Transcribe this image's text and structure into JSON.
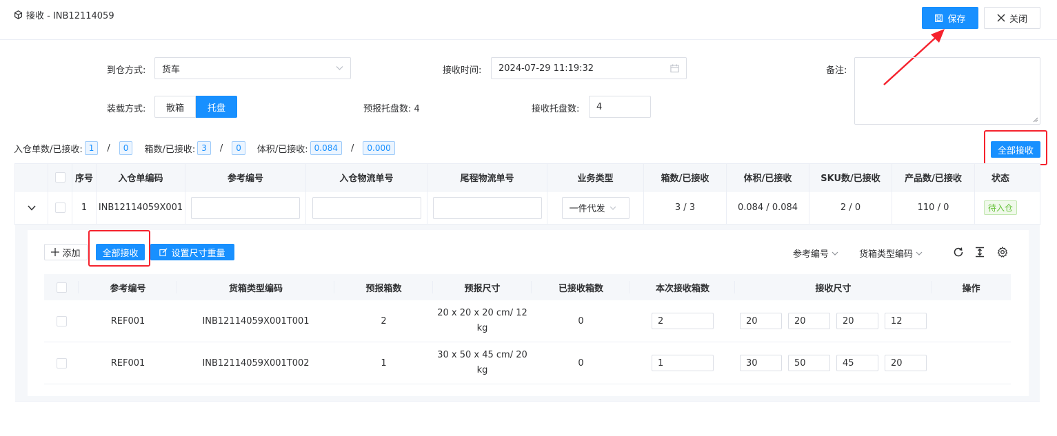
{
  "header": {
    "title": "接收 - INB12114059",
    "save_label": "保存",
    "close_label": "关闭"
  },
  "form": {
    "arrival_label": "到仓方式:",
    "arrival_value": "货车",
    "receive_time_label": "接收时间:",
    "receive_time_value": "2024-07-29 11:19:32",
    "remark_label": "备注:",
    "load_label": "装载方式:",
    "load_options": [
      "散箱",
      "托盘"
    ],
    "load_selected": "托盘",
    "forecast_pallet_label": "预报托盘数:",
    "forecast_pallet_value": "4",
    "received_pallet_label": "接收托盘数:",
    "received_pallet_value": "4"
  },
  "summary": {
    "orders_label": "入仓单数/已接收:",
    "orders_total": "1",
    "orders_received": "0",
    "boxes_label": "箱数/已接收:",
    "boxes_total": "3",
    "boxes_received": "0",
    "volume_label": "体积/已接收:",
    "volume_total": "0.084",
    "volume_received": "0.000",
    "slash": "/",
    "receive_all_label": "全部接收"
  },
  "main_table": {
    "columns": [
      "序号",
      "入仓单编码",
      "参考编号",
      "入仓物流单号",
      "尾程物流单号",
      "业务类型",
      "箱数/已接收",
      "体积/已接收",
      "SKU数/已接收",
      "产品数/已接收",
      "状态"
    ],
    "rows": [
      {
        "index": "1",
        "code": "INB12114059X001",
        "business_type": "一件代发",
        "boxes": "3 / 3",
        "volume": "0.084 / 0.084",
        "sku": "2 / 0",
        "products": "110 / 0",
        "status": "待入仓"
      }
    ]
  },
  "sub": {
    "add_label": "添加",
    "receive_all_label": "全部接收",
    "set_size_label": "设置尺寸重量",
    "filter_ref": "参考编号",
    "filter_box_type": "货箱类型编码",
    "columns": [
      "参考编号",
      "货箱类型编码",
      "预报箱数",
      "预报尺寸",
      "已接收箱数",
      "本次接收箱数",
      "接收尺寸",
      "操作"
    ],
    "rows": [
      {
        "ref": "REF001",
        "box_code": "INB12114059X001T001",
        "forecast_boxes": "2",
        "forecast_size_line1": "20 x 20 x 20 cm/ 12",
        "forecast_size_line2": "kg",
        "received_boxes": "0",
        "this_receive": "2",
        "size": [
          "20",
          "20",
          "20",
          "12"
        ]
      },
      {
        "ref": "REF001",
        "box_code": "INB12114059X001T002",
        "forecast_boxes": "1",
        "forecast_size_line1": "30 x 50 x 45 cm/ 20",
        "forecast_size_line2": "kg",
        "received_boxes": "0",
        "this_receive": "1",
        "size": [
          "30",
          "50",
          "45",
          "20"
        ]
      }
    ]
  },
  "colors": {
    "primary": "#1890ff",
    "highlight": "#f5222d",
    "success": "#67c23a"
  }
}
